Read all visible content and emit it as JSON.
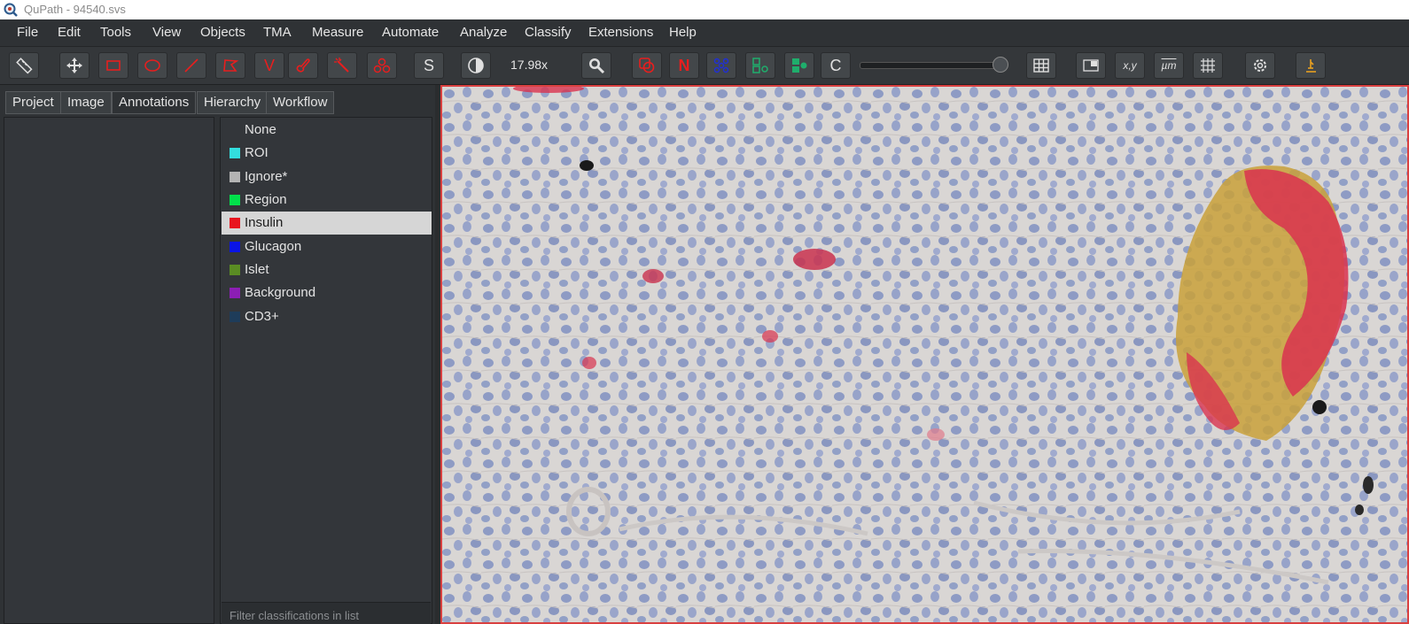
{
  "window": {
    "title": "QuPath - 94540.svs"
  },
  "menu": [
    "File",
    "Edit",
    "Tools",
    "View",
    "Objects",
    "TMA",
    "Measure",
    "Automate",
    "Analyze",
    "Classify",
    "Extensions",
    "Help"
  ],
  "toolbar": {
    "zoom": "17.98x",
    "s_label": "S",
    "n_label": "N",
    "c_label": "C",
    "v_label": "V",
    "xy_label": "x,y",
    "um_label": "µm"
  },
  "tabs": [
    "Project",
    "Image",
    "Annotations",
    "Hierarchy",
    "Workflow"
  ],
  "classes": [
    {
      "label": "None",
      "color": ""
    },
    {
      "label": "ROI",
      "color": "#33dede"
    },
    {
      "label": "Ignore*",
      "color": "#b4b4b4"
    },
    {
      "label": "Region",
      "color": "#00e04a"
    },
    {
      "label": "Insulin",
      "color": "#e8141e",
      "selected": true
    },
    {
      "label": "Glucagon",
      "color": "#0a14e6"
    },
    {
      "label": "Islet",
      "color": "#5a8c23"
    },
    {
      "label": "Background",
      "color": "#8c1eb4"
    },
    {
      "label": "CD3+",
      "color": "#1e3c5a"
    }
  ],
  "filter_placeholder": "Filter classifications in list"
}
